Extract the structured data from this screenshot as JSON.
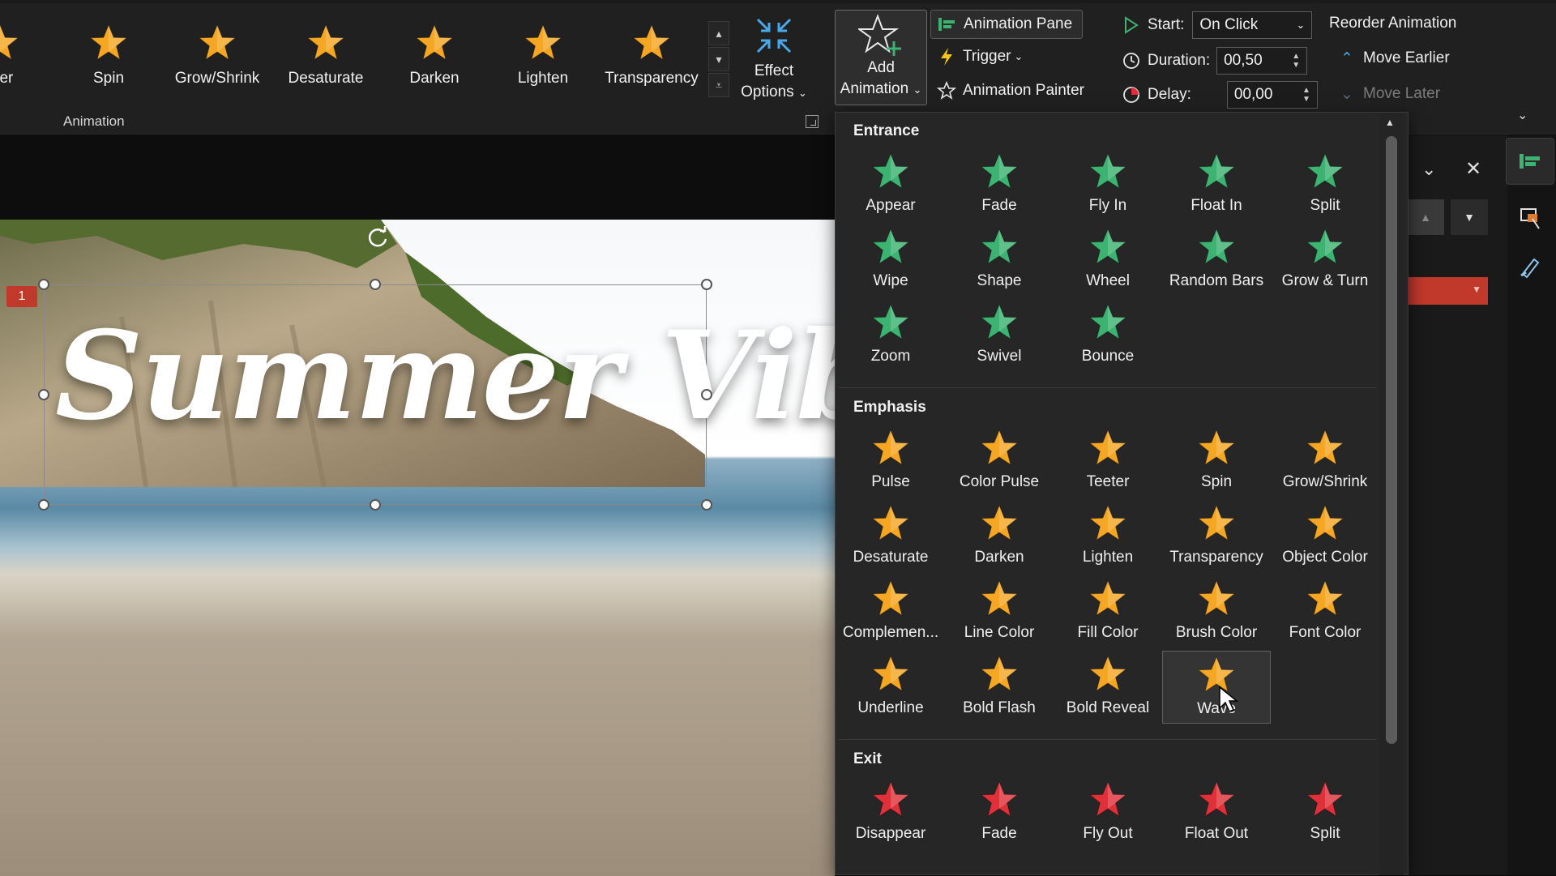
{
  "ribbon": {
    "gallery": [
      {
        "label": "eter",
        "icon": "teeter-star-icon",
        "color": "#f5a623"
      },
      {
        "label": "Spin",
        "icon": "spin-star-icon",
        "color": "#f5a623"
      },
      {
        "label": "Grow/Shrink",
        "icon": "grow-shrink-star-icon",
        "color": "#f5a623"
      },
      {
        "label": "Desaturate",
        "icon": "desaturate-star-icon",
        "color": "#f5a623"
      },
      {
        "label": "Darken",
        "icon": "darken-star-icon",
        "color": "#f5a623"
      },
      {
        "label": "Lighten",
        "icon": "lighten-star-icon",
        "color": "#f5a623"
      },
      {
        "label": "Transparency",
        "icon": "transparency-star-icon",
        "color": "#f5a623"
      }
    ],
    "effect_options_label_1": "Effect",
    "effect_options_label_2": "Options",
    "group_label": "Animation",
    "add_animation_label_1": "Add",
    "add_animation_label_2": "Animation",
    "animation_pane_label": "Animation Pane",
    "trigger_label": "Trigger",
    "animation_painter_label": "Animation Painter",
    "start_label": "Start:",
    "start_value": "On Click",
    "duration_label": "Duration:",
    "duration_value": "00,50",
    "delay_label": "Delay:",
    "delay_value": "00,00",
    "reorder_label": "Reorder Animation",
    "move_earlier_label": "Move Earlier",
    "move_later_label": "Move Later"
  },
  "slide": {
    "title": "Summer Vibes",
    "animation_badge": "1"
  },
  "dropdown": {
    "sections": [
      {
        "heading": "Entrance",
        "color": "#3cb371",
        "items": [
          "Appear",
          "Fade",
          "Fly In",
          "Float In",
          "Split",
          "Wipe",
          "Shape",
          "Wheel",
          "Random Bars",
          "Grow & Turn",
          "Zoom",
          "Swivel",
          "Bounce"
        ]
      },
      {
        "heading": "Emphasis",
        "color": "#f5a623",
        "items": [
          "Pulse",
          "Color Pulse",
          "Teeter",
          "Spin",
          "Grow/Shrink",
          "Desaturate",
          "Darken",
          "Lighten",
          "Transparency",
          "Object Color",
          "Complemen...",
          "Line Color",
          "Fill Color",
          "Brush Color",
          "Font Color",
          "Underline",
          "Bold Flash",
          "Bold Reveal",
          "Wave"
        ]
      },
      {
        "heading": "Exit",
        "color": "#e0313a",
        "items": [
          "Disappear",
          "Fade",
          "Fly Out",
          "Float Out",
          "Split"
        ]
      }
    ],
    "hovered_item": "Wave"
  },
  "colors": {
    "entrance": "#3cb371",
    "emphasis": "#f5a623",
    "exit": "#e0313a",
    "badge": "#c0392b"
  }
}
